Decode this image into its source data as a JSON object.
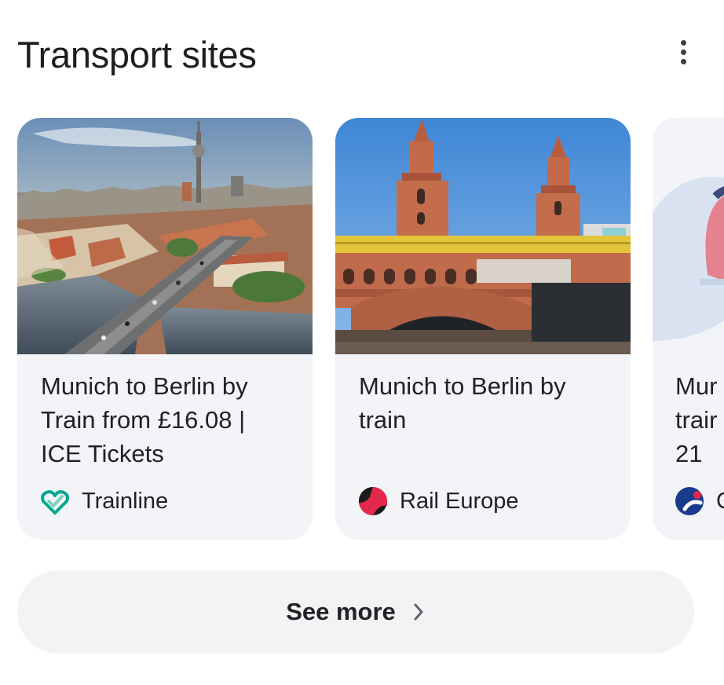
{
  "section": {
    "title": "Transport sites",
    "menu_icon": "more-vert-icon"
  },
  "cards": [
    {
      "caption": "Munich to Berlin by Train from £16.08 | ICE Tickets",
      "caption_lines": [
        "Munich to Berlin by",
        "Train from £16.08 |",
        "ICE Tickets"
      ],
      "source": "Trainline",
      "source_icon": "trainline-logo-icon",
      "thumbnail": "berlin-aerial-tv-tower-image"
    },
    {
      "caption": "Munich to Berlin by train",
      "caption_lines": [
        "Munich to Berlin by",
        "train"
      ],
      "source": "Rail Europe",
      "source_icon": "rail-europe-logo-icon",
      "thumbnail": "oberbaum-bridge-image"
    },
    {
      "caption_lines": [
        "Mur",
        "trair",
        "21"
      ],
      "source": "C",
      "source_icon": "partial-source-logo-icon",
      "thumbnail": "train-illustration-image"
    }
  ],
  "see_more": {
    "label": "See more",
    "icon": "chevron-right-icon"
  },
  "colors": {
    "card_bg": "#f3f4f7",
    "button_bg": "#f1f3f5",
    "trainline_green": "#00a88f",
    "rail_europe_red": "#e3284b"
  }
}
